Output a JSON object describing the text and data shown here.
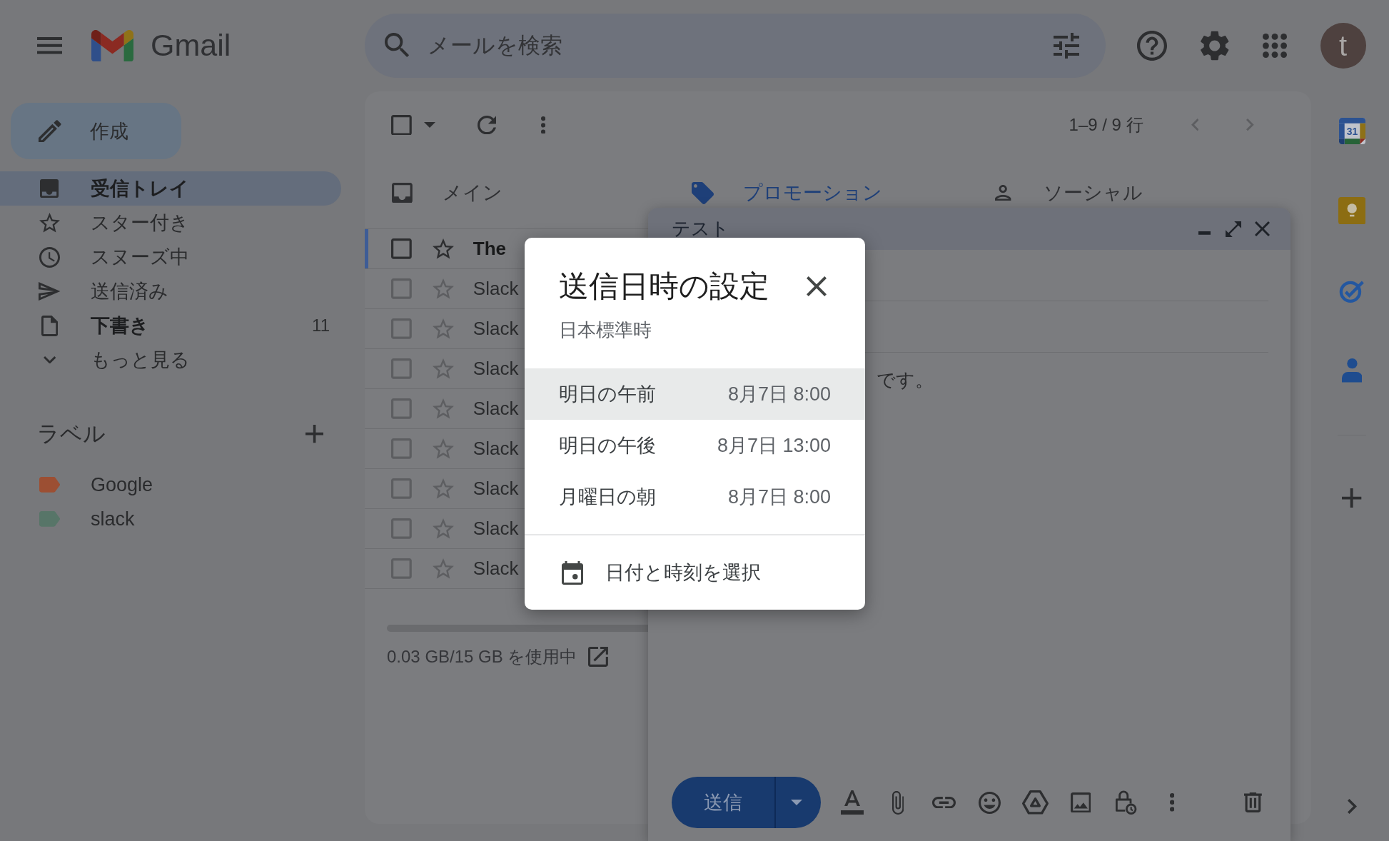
{
  "header": {
    "product_name": "Gmail",
    "search": {
      "placeholder": "メールを検索"
    },
    "avatar": {
      "initial": "t"
    }
  },
  "sidebar": {
    "compose_button": "作成",
    "items": [
      {
        "kind": "inbox",
        "label": "受信トレイ",
        "selected": true,
        "bold": true
      },
      {
        "kind": "starred",
        "label": "スター付き",
        "selected": false,
        "bold": false
      },
      {
        "kind": "snoozed",
        "label": "スヌーズ中",
        "selected": false,
        "bold": false
      },
      {
        "kind": "sent",
        "label": "送信済み",
        "selected": false,
        "bold": false
      },
      {
        "kind": "drafts",
        "label": "下書き",
        "selected": false,
        "bold": true,
        "count": "11"
      },
      {
        "kind": "more",
        "label": "もっと見る",
        "selected": false,
        "bold": false
      }
    ],
    "labels_heading": "ラベル",
    "labels": [
      {
        "name": "Google",
        "color": "#9c4f33"
      },
      {
        "name": "slack",
        "color": "#577568"
      }
    ]
  },
  "mail_list": {
    "select_all": {
      "checked": false
    },
    "pager": {
      "text": "1–9 / 9 行",
      "previous_disabled": true,
      "next_disabled": true
    },
    "tabs": [
      {
        "kind": "primary",
        "label": "メイン",
        "selected": false
      },
      {
        "kind": "promotions",
        "label": "プロモーション",
        "selected": true
      },
      {
        "kind": "social",
        "label": "ソーシャル",
        "selected": false
      }
    ],
    "emails": [
      {
        "sender": "The",
        "unread": true,
        "focused": true,
        "checked": false,
        "starred": false
      },
      {
        "sender": "Slack",
        "unread": false,
        "focused": false,
        "checked": false,
        "starred": false
      },
      {
        "sender": "Slack",
        "unread": false,
        "focused": false,
        "checked": false,
        "starred": false
      },
      {
        "sender": "Slack",
        "unread": false,
        "focused": false,
        "checked": false,
        "starred": false
      },
      {
        "sender": "Slack",
        "unread": false,
        "focused": false,
        "checked": false,
        "starred": false
      },
      {
        "sender": "Slack",
        "unread": false,
        "focused": false,
        "checked": false,
        "starred": false
      },
      {
        "sender": "Slack",
        "unread": false,
        "focused": false,
        "checked": false,
        "starred": false
      },
      {
        "sender": "Slack",
        "unread": false,
        "focused": false,
        "checked": false,
        "starred": false
      },
      {
        "sender": "Slack",
        "unread": false,
        "focused": false,
        "checked": false,
        "starred": false
      }
    ],
    "storage": "0.03 GB/15 GB を使用中"
  },
  "compose": {
    "title": "テスト",
    "body": "です。",
    "send_button": "送信"
  },
  "schedule_dialog": {
    "title": "送信日時の設定",
    "timezone": "日本標準時",
    "options": [
      {
        "label": "明日の午前",
        "time": "8月7日 8:00",
        "selected": true
      },
      {
        "label": "明日の午後",
        "time": "8月7日 13:00",
        "selected": false
      },
      {
        "label": "月曜日の朝",
        "time": "8月7日 8:00",
        "selected": false
      }
    ],
    "custom_option": "日付と時刻を選択"
  },
  "side_apps": [
    {
      "kind": "calendar",
      "day": "31"
    },
    {
      "kind": "keep"
    },
    {
      "kind": "tasks"
    },
    {
      "kind": "contacts"
    }
  ]
}
